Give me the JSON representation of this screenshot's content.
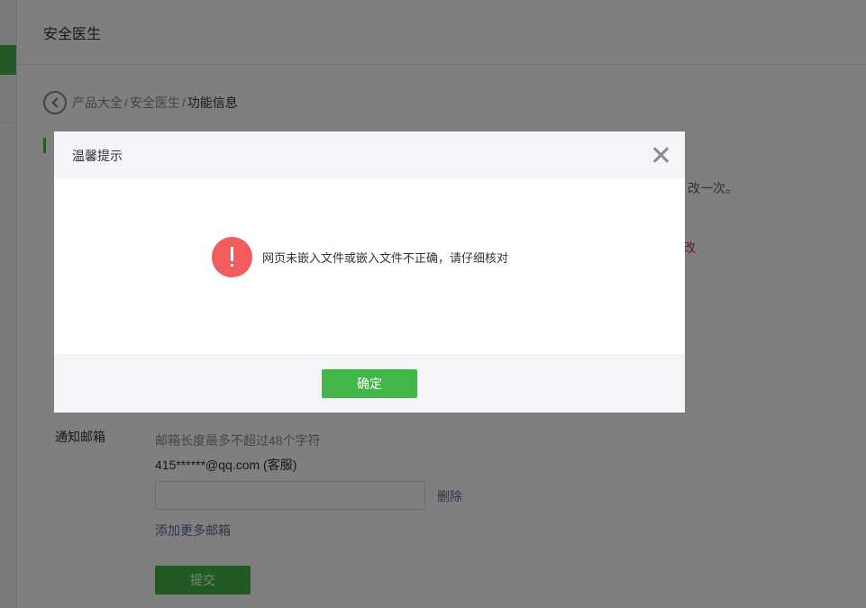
{
  "header": {
    "title": "安全医生"
  },
  "breadcrumb": {
    "items": [
      "产品大全",
      "安全医生"
    ],
    "separator": "/",
    "current": "功能信息"
  },
  "background_notes": {
    "note_1": "改一次。",
    "note_2": "改"
  },
  "email_section": {
    "label": "通知邮箱",
    "hint": "邮箱长度最多不超过48个字符",
    "existing_email": "415******@qq.com (客服)",
    "input_value": "",
    "delete_label": "删除",
    "add_more_label": "添加更多邮箱",
    "submit_label": "提交"
  },
  "dialog": {
    "title": "温馨提示",
    "icon": "exclamation-icon",
    "message": "网页未嵌入文件或嵌入文件不正确，请仔细核对",
    "confirm_label": "确定"
  },
  "colors": {
    "accent_green": "#44b549",
    "warning_red": "#f25c5c",
    "link_blue": "#576b95"
  }
}
